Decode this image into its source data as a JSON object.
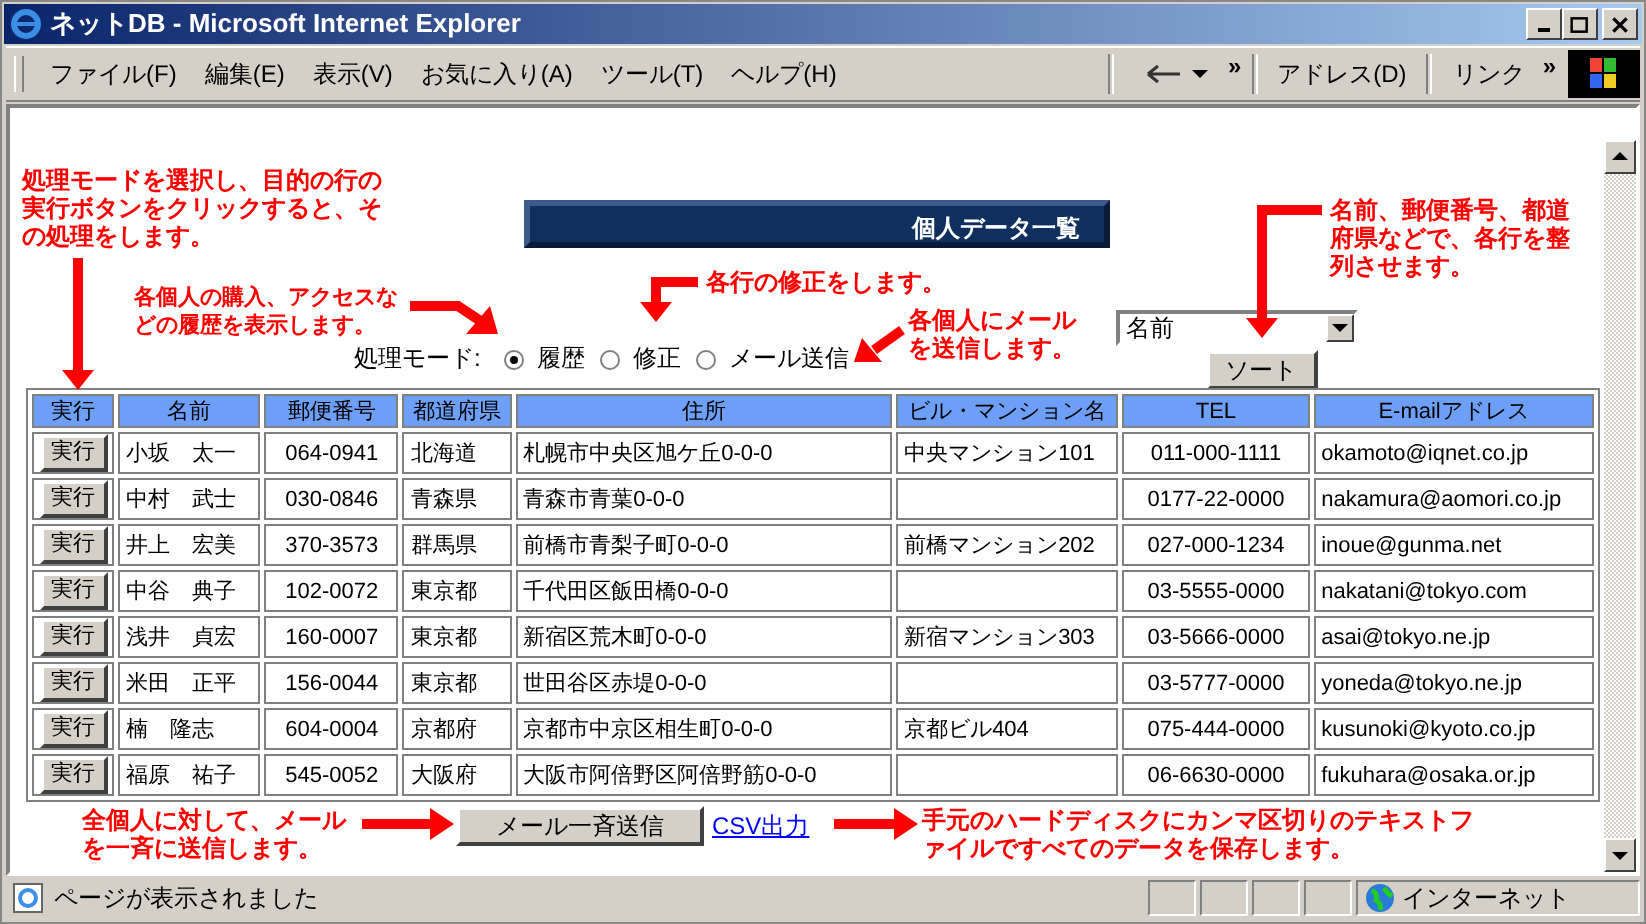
{
  "window": {
    "title": "ネットDB - Microsoft Internet Explorer"
  },
  "menu_bar": [
    "ファイル(F)",
    "編集(E)",
    "表示(V)",
    "お気に入り(A)",
    "ツール(T)",
    "ヘルプ(H)"
  ],
  "toolbar": {
    "chevron": "»",
    "address_label": "アドレス(D)",
    "links_label": "リンク",
    "links_chevron": "»"
  },
  "page": {
    "banner": "個人データ一覧",
    "mode_label": "処理モード:",
    "modes": [
      {
        "label": "履歴",
        "selected": true
      },
      {
        "label": "修正",
        "selected": false
      },
      {
        "label": "メール送信",
        "selected": false
      }
    ],
    "sort": {
      "value": "名前",
      "button": "ソート"
    },
    "table": {
      "columns": [
        "実行",
        "名前",
        "郵便番号",
        "都道府県",
        "住所",
        "ビル・マンション名",
        "TEL",
        "E-mailアドレス"
      ],
      "rows": [
        {
          "cells": [
            "実行",
            "小坂　太一",
            "064-0941",
            "北海道",
            "札幌市中央区旭ケ丘0-0-0",
            "中央マンション101",
            "011-000-1111",
            "okamoto@iqnet.co.jp"
          ]
        },
        {
          "cells": [
            "実行",
            "中村　武士",
            "030-0846",
            "青森県",
            "青森市青葉0-0-0",
            "",
            "0177-22-0000",
            "nakamura@aomori.co.jp"
          ]
        },
        {
          "cells": [
            "実行",
            "井上　宏美",
            "370-3573",
            "群馬県",
            "前橋市青梨子町0-0-0",
            "前橋マンション202",
            "027-000-1234",
            "inoue@gunma.net"
          ]
        },
        {
          "cells": [
            "実行",
            "中谷　典子",
            "102-0072",
            "東京都",
            "千代田区飯田橋0-0-0",
            "",
            "03-5555-0000",
            "nakatani@tokyo.com"
          ]
        },
        {
          "cells": [
            "実行",
            "浅井　貞宏",
            "160-0007",
            "東京都",
            "新宿区荒木町0-0-0",
            "新宿マンション303",
            "03-5666-0000",
            "asai@tokyo.ne.jp"
          ]
        },
        {
          "cells": [
            "実行",
            "米田　正平",
            "156-0044",
            "東京都",
            "世田谷区赤堤0-0-0",
            "",
            "03-5777-0000",
            "yoneda@tokyo.ne.jp"
          ]
        },
        {
          "cells": [
            "実行",
            "楠　隆志",
            "604-0004",
            "京都府",
            "京都市中京区相生町0-0-0",
            "京都ビル404",
            "075-444-0000",
            "kusunoki@kyoto.co.jp"
          ]
        },
        {
          "cells": [
            "実行",
            "福原　祐子",
            "545-0052",
            "大阪府",
            "大阪市阿倍野区阿倍野筋0-0-0",
            "",
            "06-6630-0000",
            "fukuhara@osaka.or.jp"
          ]
        }
      ]
    },
    "mail_button": "メール一斉送信",
    "csv_link": "CSV出力"
  },
  "annotations": [
    "処理モードを選択し、目的の行の実行ボタンをクリックすると、その処理をします。",
    "各個人の購入、アクセスなどの履歴を表示します。",
    "各行の修正をします。",
    "各個人にメールを送信します。",
    "名前、郵便番号、都道府県などで、各行を整列させます。",
    "全個人に対して、メールを一斉に送信します。",
    "手元のハードディスクにカンマ区切りのテキストファイルですべてのデータを保存します。"
  ],
  "status_bar": {
    "text": "ページが表示されました",
    "zone": "インターネット"
  }
}
